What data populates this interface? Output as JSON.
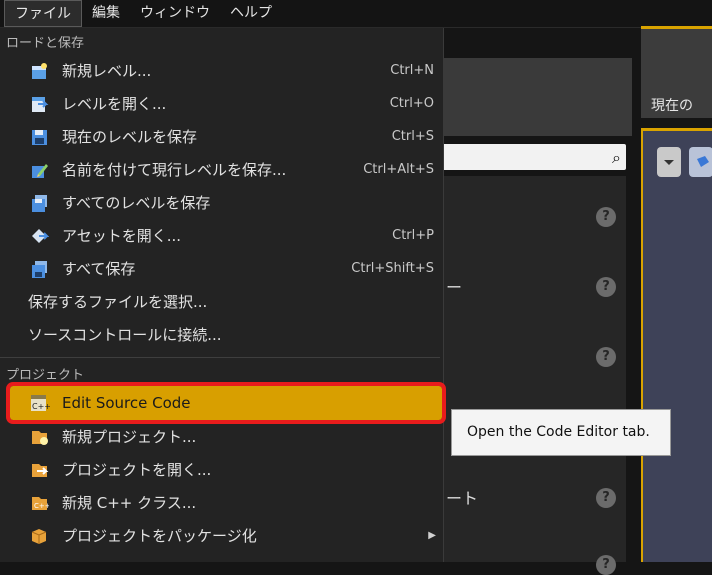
{
  "menubar": {
    "items": [
      {
        "label": "ファイル"
      },
      {
        "label": "編集"
      },
      {
        "label": "ウィンドウ"
      },
      {
        "label": "ヘルプ"
      }
    ]
  },
  "file_menu": {
    "section_load_save": "ロードと保存",
    "section_project": "プロジェクト",
    "items": [
      {
        "label": "新規レベル...",
        "shortcut": "Ctrl+N",
        "icon": "new-level-icon"
      },
      {
        "label": "レベルを開く...",
        "shortcut": "Ctrl+O",
        "icon": "open-level-icon"
      },
      {
        "label": "現在のレベルを保存",
        "shortcut": "Ctrl+S",
        "icon": "save-icon"
      },
      {
        "label": "名前を付けて現行レベルを保存...",
        "shortcut": "Ctrl+Alt+S",
        "icon": "save-as-icon"
      },
      {
        "label": "すべてのレベルを保存",
        "shortcut": "",
        "icon": "save-all-levels-icon"
      },
      {
        "label": "アセットを開く...",
        "shortcut": "Ctrl+P",
        "icon": "open-asset-icon"
      },
      {
        "label": "すべて保存",
        "shortcut": "Ctrl+Shift+S",
        "icon": "save-all-icon"
      },
      {
        "label": "保存するファイルを選択...",
        "shortcut": "",
        "icon": ""
      },
      {
        "label": "ソースコントロールに接続...",
        "shortcut": "",
        "icon": ""
      }
    ],
    "project_items": [
      {
        "label": "Edit Source Code",
        "icon": "cpp-code-icon"
      },
      {
        "label": "新規プロジェクト...",
        "icon": "new-project-icon"
      },
      {
        "label": "プロジェクトを開く...",
        "icon": "open-project-icon"
      },
      {
        "label": "新規 C++ クラス...",
        "icon": "new-cpp-class-icon"
      },
      {
        "label": "プロジェクトをパッケージ化",
        "icon": "package-icon"
      }
    ]
  },
  "tooltip": {
    "text": "Open the Code Editor tab."
  },
  "background": {
    "viewport_tab_label": "現在の",
    "dash_1": "ー",
    "dash_2": "ート",
    "help_glyph": "?"
  },
  "colors": {
    "highlight": "#d89f00",
    "highlight_outline": "#e81c1c",
    "accent_tab": "#d9a300"
  }
}
